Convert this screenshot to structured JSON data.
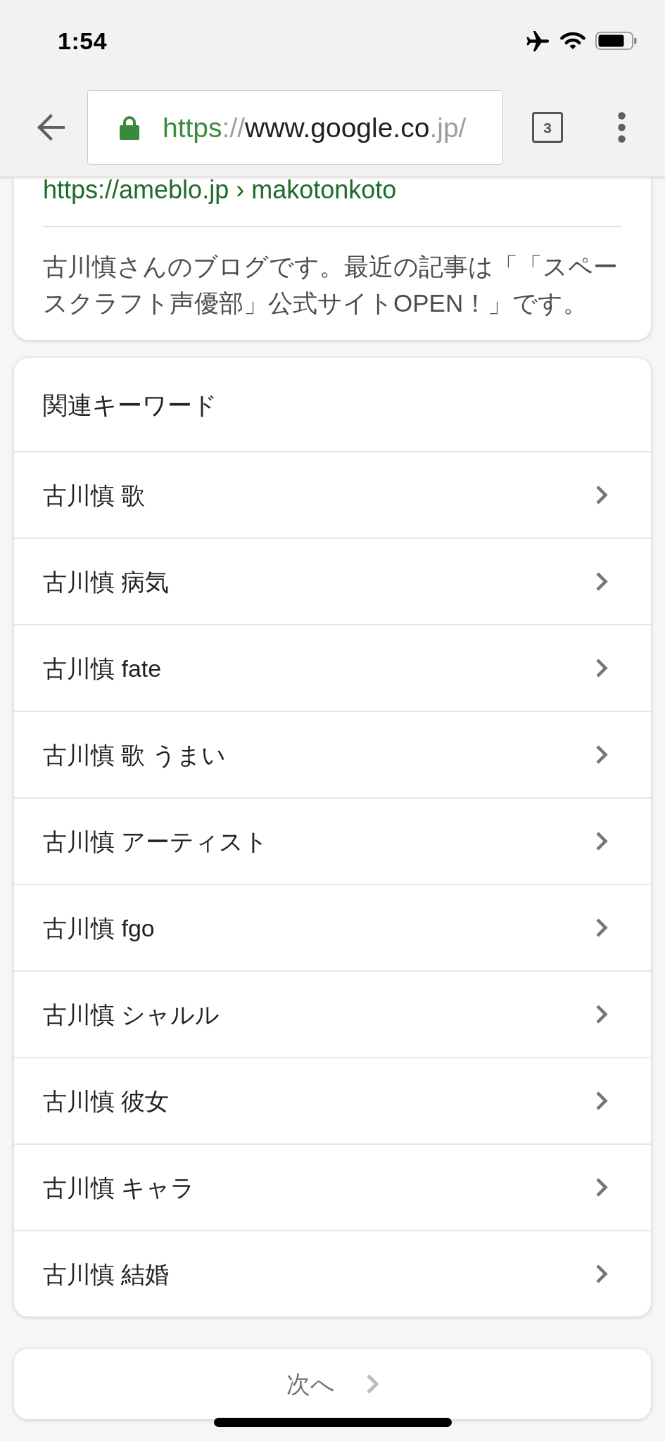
{
  "status_bar": {
    "time": "1:54"
  },
  "toolbar": {
    "address": [
      {
        "text": "https",
        "kind": "scheme"
      },
      {
        "text": "://",
        "kind": "dim"
      },
      {
        "text": "www.google.co",
        "kind": "host"
      },
      {
        "text": ".jp/",
        "kind": "dim"
      }
    ],
    "tab_count": "3"
  },
  "result": {
    "url": "https://ameblo.jp › makotonkoto",
    "snippet": "古川慎さんのブログです。最近の記事は「「スペースクラフト声優部」公式サイトOPEN！」です。"
  },
  "related_keywords": {
    "title": "関連キーワード",
    "items": [
      "古川慎 歌",
      "古川慎 病気",
      "古川慎 fate",
      "古川慎 歌 うまい",
      "古川慎 アーティスト",
      "古川慎 fgo",
      "古川慎 シャルル",
      "古川慎 彼女",
      "古川慎 キャラ",
      "古川慎 結婚"
    ]
  },
  "pagination": {
    "next": "次へ"
  }
}
